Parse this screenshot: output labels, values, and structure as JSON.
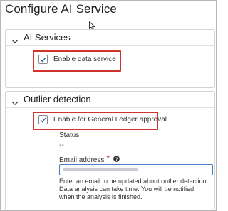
{
  "page": {
    "title": "Configure AI Service"
  },
  "sections": {
    "ai_services": {
      "title": "AI Services",
      "checkbox_label": "Enable data service",
      "checked": true
    },
    "outlier_detection": {
      "title": "Outlier detection",
      "checkbox_label": "Enable for General Ledger approval",
      "checked": true,
      "status_label": "Status",
      "status_value": "--",
      "email_label": "Email address",
      "required_marker": "*",
      "email_value": "",
      "help_text": "Enter an email to be updated about outlier detection. Data analysis can take time. You will be notified when the analysis is finished."
    }
  },
  "colors": {
    "highlight": "#d0322e",
    "input_border": "#4a7fbe",
    "required": "#a4262c"
  },
  "icons": {
    "collapse": "chevron-down-icon",
    "check": "checkmark-icon",
    "help": "question-circle-icon",
    "pointer": "mouse-cursor-icon"
  }
}
